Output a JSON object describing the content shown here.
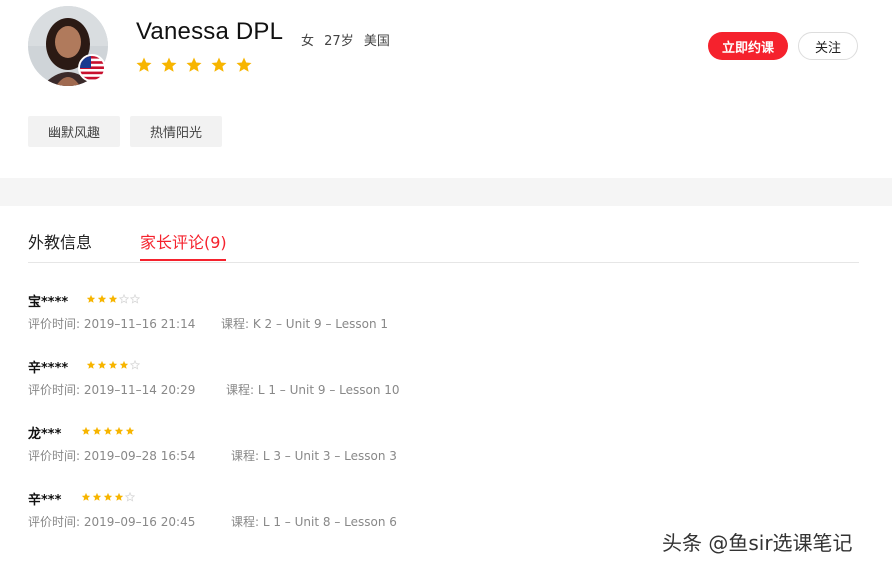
{
  "profile": {
    "name": "Vanessa DPL",
    "gender": "女",
    "age": "27岁",
    "country": "美国",
    "rating": 5,
    "avatar_icon": "teacher-avatar",
    "flag_icon": "us-flag-icon"
  },
  "actions": {
    "book_label": "立即约课",
    "follow_label": "关注"
  },
  "tags": [
    "幽默风趣",
    "热情阳光"
  ],
  "tabs": [
    {
      "label": "外教信息",
      "active": false
    },
    {
      "label": "家长评论(9)",
      "active": true
    }
  ],
  "reviews": [
    {
      "user": "宝****",
      "rating": 3,
      "time": "评价时间: 2019–11–16 21:14",
      "course": "课程: K 2 – Unit 9 – Lesson 1"
    },
    {
      "user": "辛****",
      "rating": 4,
      "time": "评价时间: 2019–11–14 20:29",
      "course": "课程: L 1 – Unit 9 – Lesson 10"
    },
    {
      "user": "龙***",
      "rating": 5,
      "time": "评价时间: 2019–09–28 16:54",
      "course": "课程: L 3 – Unit 3 – Lesson 3"
    },
    {
      "user": "辛***",
      "rating": 4,
      "time": "评价时间: 2019–09–16 20:45",
      "course": "课程: L 1 – Unit 8 – Lesson 6"
    }
  ],
  "watermark": "头条 @鱼sir选课笔记",
  "colors": {
    "accent": "#f5222d",
    "star": "#f7b500",
    "star_empty": "#d9d9d9"
  }
}
